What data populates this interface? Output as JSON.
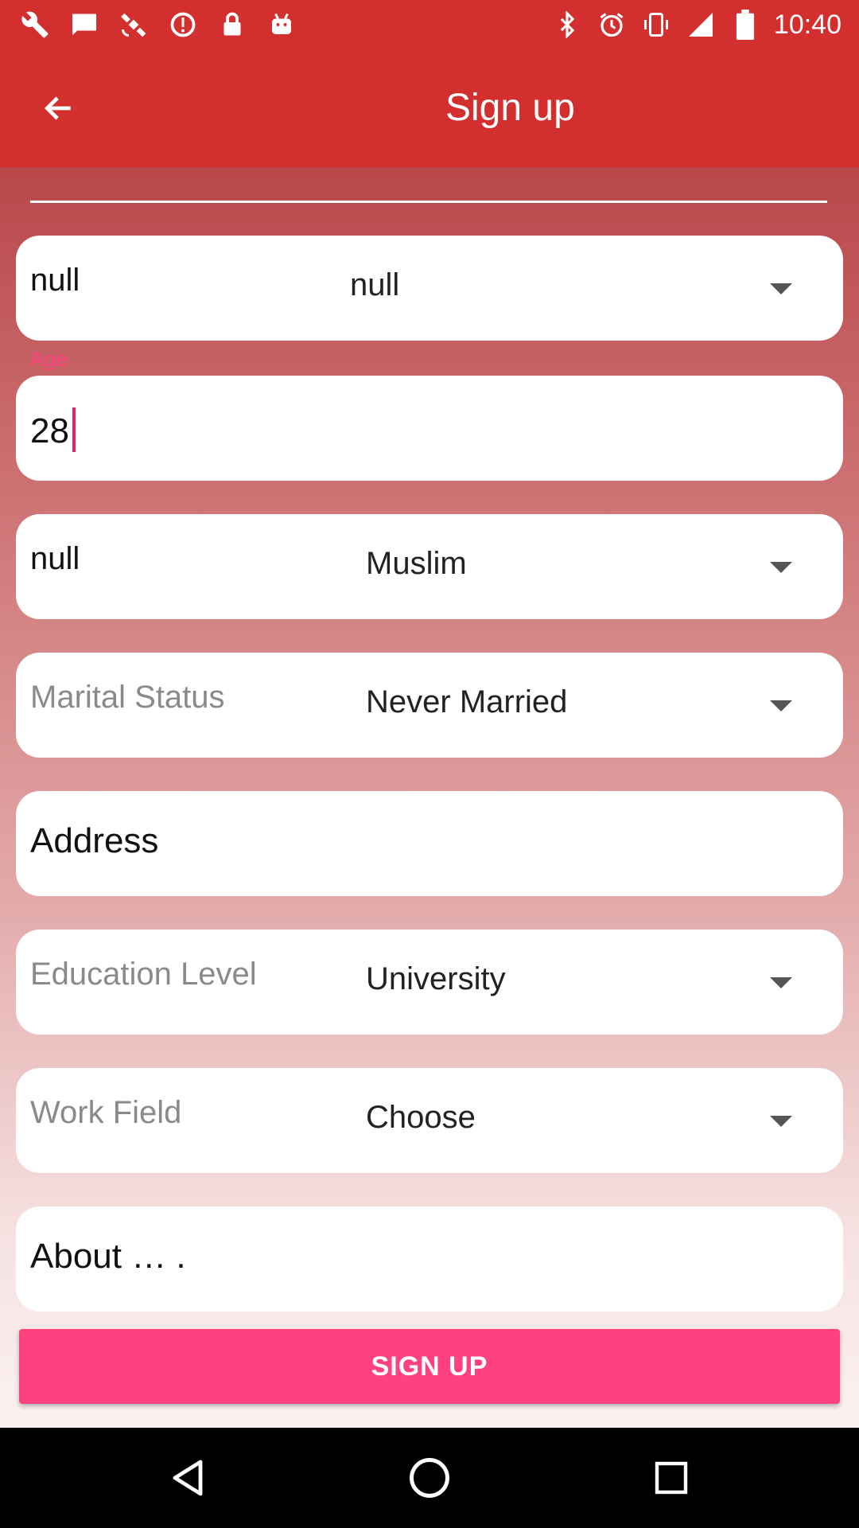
{
  "status_bar": {
    "time": "10:40",
    "left_icons": [
      "wrench-icon",
      "chat-icon",
      "satellite-icon",
      "data-saver-icon",
      "lock-icon",
      "android-icon"
    ],
    "right_icons": [
      "bluetooth-icon",
      "alarm-icon",
      "vibrate-icon",
      "cellular-icon",
      "battery-icon"
    ]
  },
  "app_bar": {
    "title": "Sign up",
    "background": "#d32f2f"
  },
  "form": {
    "row1": {
      "label": "null",
      "value": "null"
    },
    "age": {
      "label": "Age",
      "value": "28"
    },
    "religion": {
      "label": "null",
      "value": "Muslim"
    },
    "marital": {
      "placeholder": "Marital Status",
      "value": "Never Married"
    },
    "address": {
      "label": "Address"
    },
    "education": {
      "placeholder": "Education Level",
      "value": "University"
    },
    "work": {
      "placeholder": "Work Field",
      "value": "Choose"
    },
    "about": {
      "label": "About … ."
    }
  },
  "signup_button": {
    "label": "SIGN UP",
    "color": "#ff4081"
  },
  "nav_bar": [
    "back-triangle-icon",
    "home-circle-icon",
    "recents-square-icon"
  ]
}
